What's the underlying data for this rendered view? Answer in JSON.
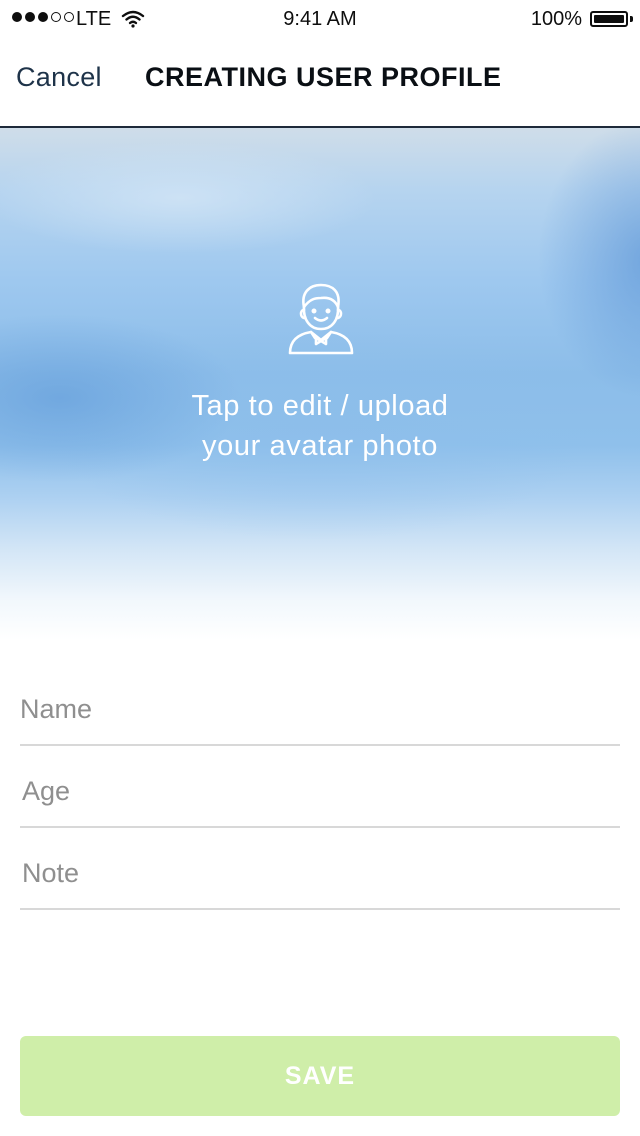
{
  "status_bar": {
    "signal_bars_filled": 3,
    "signal_bars_total": 5,
    "carrier": "LTE",
    "wifi_icon": "wifi-icon",
    "time": "9:41 AM",
    "battery_percent": "100%",
    "battery_level": 1.0
  },
  "nav": {
    "cancel_label": "Cancel",
    "title": "CREATING USER PROFILE"
  },
  "avatar": {
    "icon": "user-avatar-icon",
    "caption_line1": "Tap to edit / upload",
    "caption_line2": "your avatar photo"
  },
  "form": {
    "name": {
      "placeholder": "Name",
      "value": ""
    },
    "age": {
      "placeholder": "Age",
      "value": ""
    },
    "note": {
      "placeholder": "Note",
      "value": ""
    }
  },
  "save": {
    "label": "SAVE"
  },
  "colors": {
    "save_button": "#cfeea9",
    "nav_text": "#1e3349",
    "field_divider": "#d8d8d8",
    "placeholder": "#8f8f8f"
  }
}
